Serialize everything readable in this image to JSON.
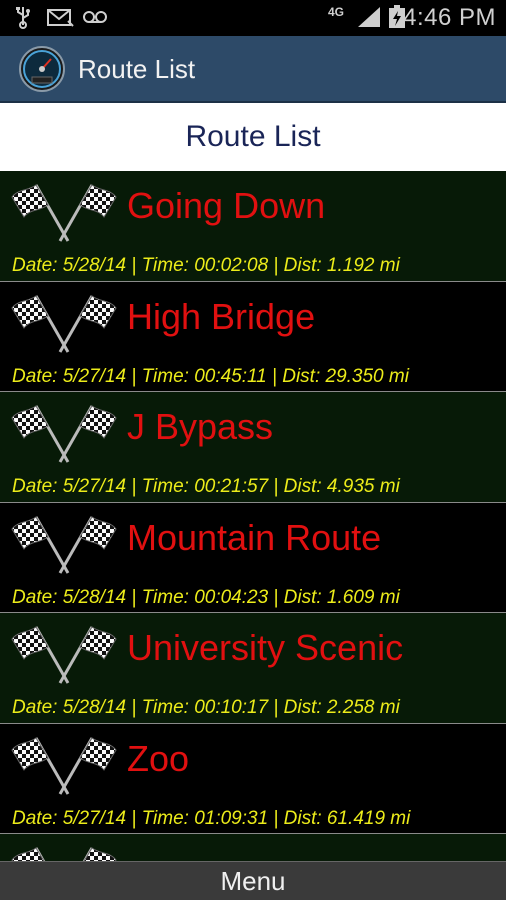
{
  "status_bar": {
    "icons": [
      "usb-icon",
      "mail-icon",
      "voicemail-icon",
      "network-4g-icon",
      "signal-icon",
      "battery-charging-icon"
    ],
    "network": "4G",
    "time": "4:46 PM"
  },
  "action_bar": {
    "app_icon": "speedometer-icon",
    "title": "Route List"
  },
  "header": {
    "title": "Route List"
  },
  "routes": [
    {
      "name": "Going Down",
      "meta": "Date: 5/28/14 | Time: 00:02:08 | Dist: 1.192 mi"
    },
    {
      "name": "High Bridge",
      "meta": "Date: 5/27/14 | Time: 00:45:11 | Dist: 29.350 mi"
    },
    {
      "name": "J Bypass",
      "meta": "Date: 5/27/14 | Time: 00:21:57 | Dist: 4.935 mi"
    },
    {
      "name": "Mountain Route",
      "meta": "Date: 5/28/14 | Time: 00:04:23 | Dist: 1.609 mi"
    },
    {
      "name": "University Scenic",
      "meta": "Date: 5/28/14 | Time: 00:10:17 | Dist: 2.258 mi"
    },
    {
      "name": "Zoo",
      "meta": "Date: 5/27/14 | Time: 01:09:31 | Dist: 61.419 mi"
    }
  ],
  "menu": {
    "label": "Menu"
  },
  "colors": {
    "action_bar": "#2d4a68",
    "route_name": "#e11010",
    "route_meta": "#ecec1a",
    "alt_row": "#071a07"
  }
}
